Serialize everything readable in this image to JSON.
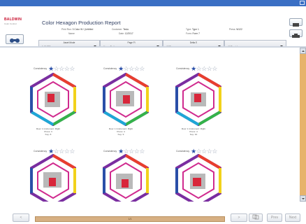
{
  "app": {
    "brand": "BALDWIN",
    "brand_sub": "Color Control",
    "title": "Color Hexagon Production Report"
  },
  "meta": {
    "print_run_label": "Print Run",
    "print_run_value": "3 Color W / (Untitled",
    "name_label": "Name",
    "customer_label": "Customer",
    "customer_value": "Tesla",
    "date_label": "Date",
    "date_value": "12/2017",
    "type_label": "Type",
    "type_value": "Type 1",
    "form_label": "Form",
    "form_value": "Form 7",
    "press_label": "Press",
    "press_value": "W122"
  },
  "filters": [
    {
      "label": "Asset Mode",
      "value": "1 40 300"
    },
    {
      "label": "Page Fi",
      "value": "Upper Surface"
    },
    {
      "label": "Delta E",
      "value": "All Rows"
    },
    {
      "label": "",
      "value": "All Swatches"
    }
  ],
  "consistency_label": "Consistency",
  "hexagons": [
    {
      "consistency": 1,
      "note_l1": "Row: 1   Instrument: Right",
      "note_l2": "Press: 3",
      "note_l3": "Key: 8"
    },
    {
      "consistency": 1,
      "note_l1": "Row: 1   Instrument: Right",
      "note_l2": "Press: 4",
      "note_l3": "Key: 9"
    },
    {
      "consistency": 1,
      "note_l1": "Row: 1   Instrument: Right",
      "note_l2": "Press: 4",
      "note_l3": "Key: 10"
    },
    {
      "consistency": 1,
      "note_l1": "",
      "note_l2": "",
      "note_l3": ""
    },
    {
      "consistency": 1,
      "note_l1": "",
      "note_l2": "",
      "note_l3": ""
    },
    {
      "consistency": 1,
      "note_l1": "",
      "note_l2": "",
      "note_l3": ""
    }
  ],
  "footer": {
    "page": "1/1",
    "prev_label": "<",
    "next_label": ">",
    "btn_a": "Prev",
    "btn_b": "Next"
  },
  "colors": {
    "titlebar": "#3a6fc4",
    "accent_panel": "#e7b36b",
    "star": "#2a4fa8"
  }
}
